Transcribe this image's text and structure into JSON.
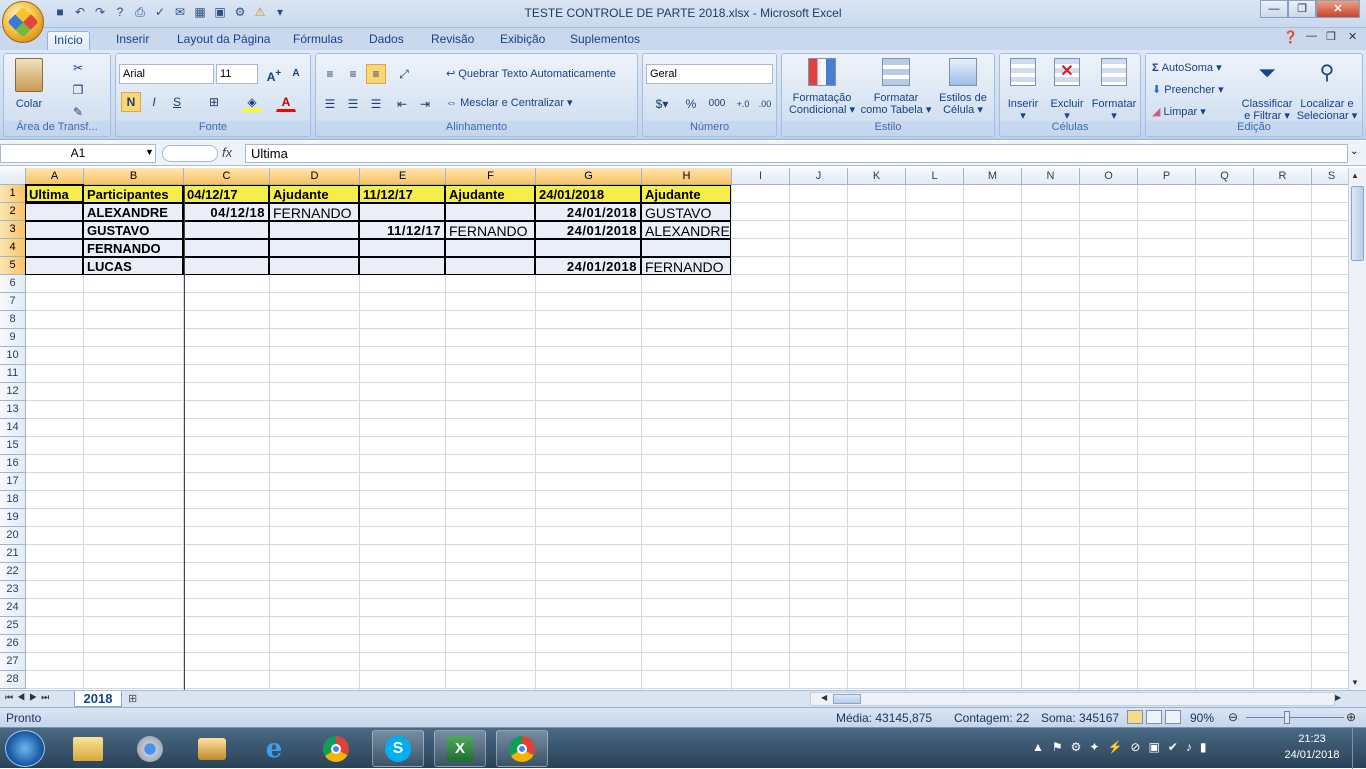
{
  "window": {
    "title": "TESTE CONTROLE DE PARTE 2018.xlsx - Microsoft Excel"
  },
  "tabs": [
    "Início",
    "Inserir",
    "Layout da Página",
    "Fórmulas",
    "Dados",
    "Revisão",
    "Exibição",
    "Suplementos"
  ],
  "ribbon": {
    "clipboard": {
      "label": "Área de Transf...",
      "paste": "Colar"
    },
    "font": {
      "label": "Fonte",
      "name": "Arial",
      "size": "11",
      "bold": "N",
      "italic": "I",
      "underline": "S"
    },
    "alignment": {
      "label": "Alinhamento",
      "wrap": "Quebrar Texto Automaticamente",
      "merge": "Mesclar e Centralizar"
    },
    "number": {
      "label": "Número",
      "format": "Geral",
      "percent": "%",
      "thousands": "000"
    },
    "styles": {
      "label": "Estilo",
      "cond1": "Formatação",
      "cond2": "Condicional",
      "table1": "Formatar",
      "table2": "como Tabela",
      "cell1": "Estilos de",
      "cell2": "Célula"
    },
    "cells": {
      "label": "Células",
      "insert": "Inserir",
      "delete": "Excluir",
      "format": "Formatar"
    },
    "editing": {
      "label": "Edição",
      "autosum": "AutoSoma",
      "fill": "Preencher",
      "clear": "Limpar",
      "sort1": "Classificar",
      "sort2": "e Filtrar",
      "find1": "Localizar e",
      "find2": "Selecionar"
    }
  },
  "formula_bar": {
    "name_box": "A1",
    "fx": "fx",
    "content": "Ultima"
  },
  "sheet": {
    "columns": [
      "A",
      "B",
      "C",
      "D",
      "E",
      "F",
      "G",
      "H",
      "I",
      "J",
      "K",
      "L",
      "M",
      "N",
      "O",
      "P",
      "Q",
      "R",
      "S"
    ],
    "rows": [
      "1",
      "2",
      "3",
      "4",
      "5",
      "6",
      "7",
      "8",
      "9",
      "10",
      "11",
      "12",
      "13",
      "14",
      "15",
      "16",
      "17",
      "18",
      "19",
      "20",
      "21",
      "22",
      "23",
      "24",
      "25",
      "26",
      "27",
      "28"
    ],
    "cells": {
      "r1": [
        "Ultima",
        "Participantes",
        "04/12/17",
        "Ajudante",
        "11/12/17",
        "Ajudante",
        "24/01/2018",
        "Ajudante"
      ],
      "r2": [
        "",
        "ALEXANDRE",
        "04/12/18",
        "FERNANDO",
        "",
        "",
        "24/01/2018",
        "GUSTAVO"
      ],
      "r3": [
        "",
        "GUSTAVO",
        "",
        "",
        "11/12/17",
        "FERNANDO",
        "24/01/2018",
        "ALEXANDRE"
      ],
      "r4": [
        "",
        "FERNANDO",
        "",
        "",
        "",
        "",
        "",
        ""
      ],
      "r5": [
        "",
        "LUCAS",
        "",
        "",
        "",
        "",
        "24/01/2018",
        "FERNANDO"
      ]
    },
    "header_fill": "#f5ee4a"
  },
  "sheet_tab": "2018",
  "status": {
    "ready": "Pronto",
    "average": "Média: 43145,875",
    "count": "Contagem: 22",
    "sum": "Soma: 345167",
    "zoom": "90%"
  },
  "taskbar": {
    "time": "21:23",
    "date": "24/01/2018"
  }
}
